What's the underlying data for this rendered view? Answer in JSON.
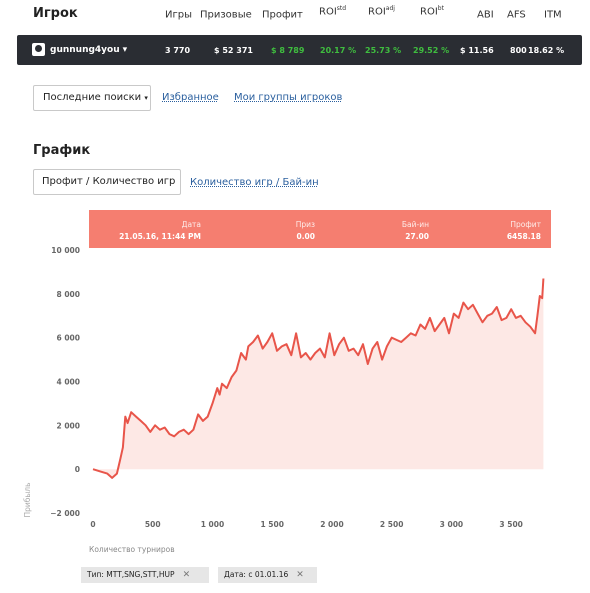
{
  "header": {
    "title": "Игрок",
    "columns": [
      {
        "label": "Игры",
        "sup": ""
      },
      {
        "label": "Призовые",
        "sup": ""
      },
      {
        "label": "Профит",
        "sup": ""
      },
      {
        "label": "ROI",
        "sup": "std"
      },
      {
        "label": "ROI",
        "sup": "adj"
      },
      {
        "label": "ROI",
        "sup": "bt"
      },
      {
        "label": "ABI",
        "sup": ""
      },
      {
        "label": "AFS",
        "sup": ""
      },
      {
        "label": "ITM",
        "sup": ""
      }
    ]
  },
  "player": {
    "name": "gunnung4you",
    "caret": "▾",
    "games": "3 770",
    "prizes": "$ 52 371",
    "profit": "$ 8 789",
    "roi_std": "20.17 %",
    "roi_adj": "25.73 %",
    "roi_bt": "29.52 %",
    "abi": "$ 11.56",
    "afs": "800",
    "itm": "18.62 %"
  },
  "nav": {
    "recent_searches": "Последние поиски",
    "favorites": "Избранное",
    "my_groups": "Мои группы игроков"
  },
  "chart_section": {
    "title": "График",
    "tab_active": "Профит / Количество игр",
    "tab_other": "Количество игр / Бай-ин"
  },
  "tooltip": {
    "date_label": "Дата",
    "date_value": "21.05.16, 11:44 PM",
    "prize_label": "Приз",
    "prize_value": "0.00",
    "buyin_label": "Бай-ин",
    "buyin_value": "27.00",
    "profit_label": "Профит",
    "profit_value": "6458.18"
  },
  "filters": [
    {
      "label": "Тип: MTT,SNG,STT,HUP",
      "close": "✕"
    },
    {
      "label": "Дата: с 01.01.16",
      "close": "✕"
    }
  ],
  "colors": {
    "bar_bg": "#2a2d33",
    "profit_green": "#3fbe3f",
    "line": "#e8554a",
    "area": "#fde8e5",
    "tooltip_bg": "#f57e70",
    "link": "#2a5f9e"
  },
  "chart_data": {
    "type": "area",
    "xlabel": "Количество турниров",
    "ylabel": "Прибыль",
    "xlim": [
      0,
      3800
    ],
    "ylim": [
      -2000,
      10000
    ],
    "x_ticks": [
      "0",
      "500",
      "1 000",
      "1 500",
      "2 000",
      "2 500",
      "3 000",
      "3 500"
    ],
    "y_ticks": [
      "10 000",
      "8 000",
      "6 000",
      "4 000",
      "2 000",
      "0",
      "−2 000"
    ],
    "series": [
      {
        "x": [
          0,
          60,
          120,
          160,
          200,
          230,
          250,
          270,
          290,
          320,
          360,
          400,
          440,
          480,
          520,
          560,
          600,
          640,
          680,
          720,
          760,
          800,
          840,
          880,
          920,
          960,
          1000,
          1040,
          1060,
          1080,
          1120,
          1160,
          1200,
          1240,
          1280,
          1300,
          1340,
          1380,
          1420,
          1460,
          1500,
          1540,
          1580,
          1620,
          1660,
          1700,
          1740,
          1780,
          1820,
          1860,
          1900,
          1940,
          1980,
          2020,
          2060,
          2100,
          2140,
          2180,
          2220,
          2260,
          2300,
          2340,
          2380,
          2420,
          2460,
          2500,
          2540,
          2580,
          2620,
          2660,
          2700,
          2740,
          2780,
          2820,
          2860,
          2900,
          2940,
          2980,
          3020,
          3060,
          3100,
          3140,
          3180,
          3220,
          3260,
          3300,
          3340,
          3380,
          3420,
          3460,
          3500,
          3540,
          3580,
          3620,
          3660,
          3700,
          3720,
          3740,
          3760,
          3770
        ],
        "y": [
          0,
          -100,
          -200,
          -400,
          -200,
          500,
          1000,
          2400,
          2100,
          2600,
          2400,
          2200,
          2000,
          1700,
          2000,
          1800,
          1900,
          1600,
          1500,
          1700,
          1800,
          1600,
          1800,
          2500,
          2200,
          2400,
          3000,
          3700,
          3400,
          3900,
          3700,
          4200,
          4500,
          5300,
          5000,
          5600,
          5800,
          6100,
          5500,
          5800,
          6200,
          5400,
          5600,
          5700,
          5200,
          6200,
          5100,
          5300,
          5000,
          5300,
          5500,
          5100,
          6200,
          5200,
          5700,
          6000,
          5400,
          5500,
          5200,
          5700,
          4800,
          5500,
          5800,
          5000,
          5600,
          6000,
          5900,
          5800,
          6000,
          6200,
          6100,
          6600,
          6400,
          6900,
          6300,
          6600,
          6900,
          6200,
          7100,
          6900,
          7600,
          7300,
          7500,
          7100,
          6700,
          7000,
          7100,
          7400,
          6800,
          6900,
          7300,
          6900,
          7000,
          6700,
          6500,
          6200,
          7000,
          7900,
          7800,
          8700
        ]
      }
    ]
  }
}
